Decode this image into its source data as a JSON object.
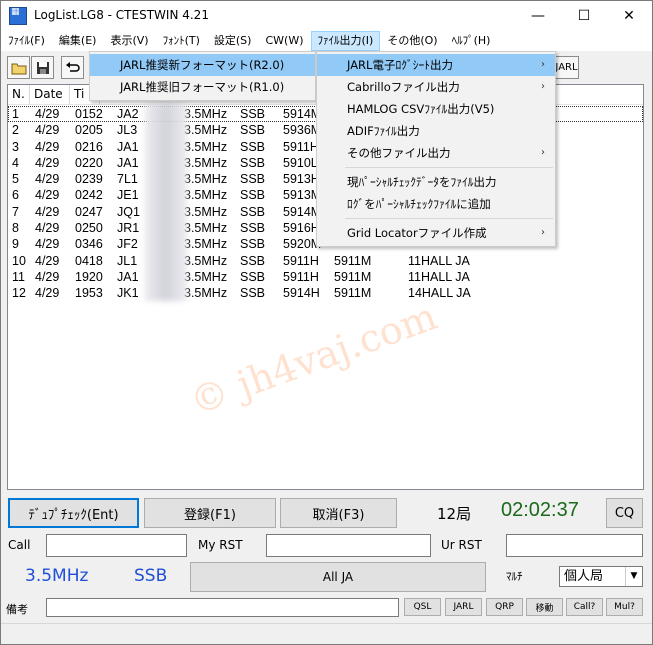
{
  "window": {
    "title": "LogList.LG8  - CTESTWIN  4.21",
    "minimize": "—",
    "maximize": "☐",
    "close": "✕"
  },
  "menu": [
    {
      "label": "ﾌｧｲﾙ(F)"
    },
    {
      "label": "編集(E)"
    },
    {
      "label": "表示(V)"
    },
    {
      "label": "ﾌｫﾝﾄ(T)"
    },
    {
      "label": "設定(S)"
    },
    {
      "label": "CW(W)"
    },
    {
      "label": "ﾌｧｲﾙ出力(I)"
    },
    {
      "label": "その他(O)"
    },
    {
      "label": "ﾍﾙﾌﾟ(H)"
    }
  ],
  "toolbar": {
    "open_icon": "folder-open-icon",
    "save_icon": "save-icon",
    "undo_icon": "undo-icon",
    "jarl_label": "JARL"
  },
  "list": {
    "columns": [
      "N.",
      "Date",
      "Ti"
    ],
    "rows": [
      [
        "1",
        "4/29",
        "0152",
        "JA2",
        "3.5MHz",
        "SSB",
        "5914M",
        "",
        ""
      ],
      [
        "2",
        "4/29",
        "0205",
        "JL3",
        "3.5MHz",
        "SSB",
        "5936M",
        "",
        ""
      ],
      [
        "3",
        "4/29",
        "0216",
        "JA1",
        "3.5MHz",
        "SSB",
        "5911H",
        "",
        ""
      ],
      [
        "4",
        "4/29",
        "0220",
        "JA1",
        "3.5MHz",
        "SSB",
        "5910L",
        "",
        ""
      ],
      [
        "5",
        "4/29",
        "0239",
        "7L1",
        "3.5MHz",
        "SSB",
        "5913H",
        "",
        ""
      ],
      [
        "6",
        "4/29",
        "0242",
        "JE1",
        "3.5MHz",
        "SSB",
        "5913M",
        "",
        ""
      ],
      [
        "7",
        "4/29",
        "0247",
        "JQ1",
        "3.5MHz",
        "SSB",
        "5914M",
        "",
        ""
      ],
      [
        "8",
        "4/29",
        "0250",
        "JR1",
        "3.5MHz",
        "SSB",
        "5916H",
        "",
        ""
      ],
      [
        "9",
        "4/29",
        "0346",
        "JF2",
        "3.5MHz",
        "SSB",
        "5920M",
        "",
        ""
      ],
      [
        "10",
        "4/29",
        "0418",
        "JL1",
        "3.5MHz",
        "SSB",
        "5911H",
        "5911M",
        "11HALL JA"
      ],
      [
        "11",
        "4/29",
        "1920",
        "JA1",
        "3.5MHz",
        "SSB",
        "5911H",
        "5911M",
        "11HALL JA"
      ],
      [
        "12",
        "4/29",
        "1953",
        "JK1",
        "3.5MHz",
        "SSB",
        "5914H",
        "5911M",
        "14HALL JA"
      ]
    ]
  },
  "watermark": "© jh4vaj.com",
  "controls": {
    "dupe_check": "ﾃﾞｭﾌﾟﾁｪｯｸ(Ent)",
    "register": "登録(F1)",
    "cancel": "取消(F3)",
    "count": "12局",
    "clock": "02:02:37",
    "cq": "CQ",
    "call_label": "Call",
    "my_rst_label": "My RST",
    "ur_rst_label": "Ur RST",
    "band": "3.5MHz",
    "mode": "SSB",
    "contest_btn": "All JA",
    "multi_label": "ﾏﾙﾁ",
    "station_type": "個人局",
    "remarks_label": "備考",
    "small_buttons": [
      "QSL",
      "JARL",
      "QRP",
      "移動",
      "Call?",
      "Mul?"
    ]
  },
  "file_menu": {
    "items": [
      "JARL推奨新フォーマット(R2.0)",
      "JARL推奨旧フォーマット(R1.0)"
    ]
  },
  "export_menu": {
    "items": [
      {
        "label": "JARL電子ﾛｸﾞｼｰﾄ出力",
        "arrow": "›"
      },
      {
        "label": "Cabrilloファイル出力",
        "arrow": "›"
      },
      {
        "label": "HAMLOG CSVﾌｧｲﾙ出力(V5)",
        "arrow": ""
      },
      {
        "label": "ADIFﾌｧｲﾙ出力",
        "arrow": ""
      },
      {
        "label": "その他ファイル出力",
        "arrow": "›"
      },
      {
        "label": "現ﾊﾟｰｼｬﾙﾁｪｯｸﾃﾞｰﾀをﾌｧｲﾙ出力",
        "arrow": ""
      },
      {
        "label": "ﾛｸﾞをﾊﾟｰｼｬﾙﾁｪｯｸﾌｧｲﾙに追加",
        "arrow": ""
      },
      {
        "label": "Grid Locatorファイル作成",
        "arrow": "›"
      }
    ]
  },
  "colors": {
    "band_blue": "#1f4fd8",
    "clock_green": "#1a6a1a",
    "menu_highlight": "#91c9f7"
  }
}
